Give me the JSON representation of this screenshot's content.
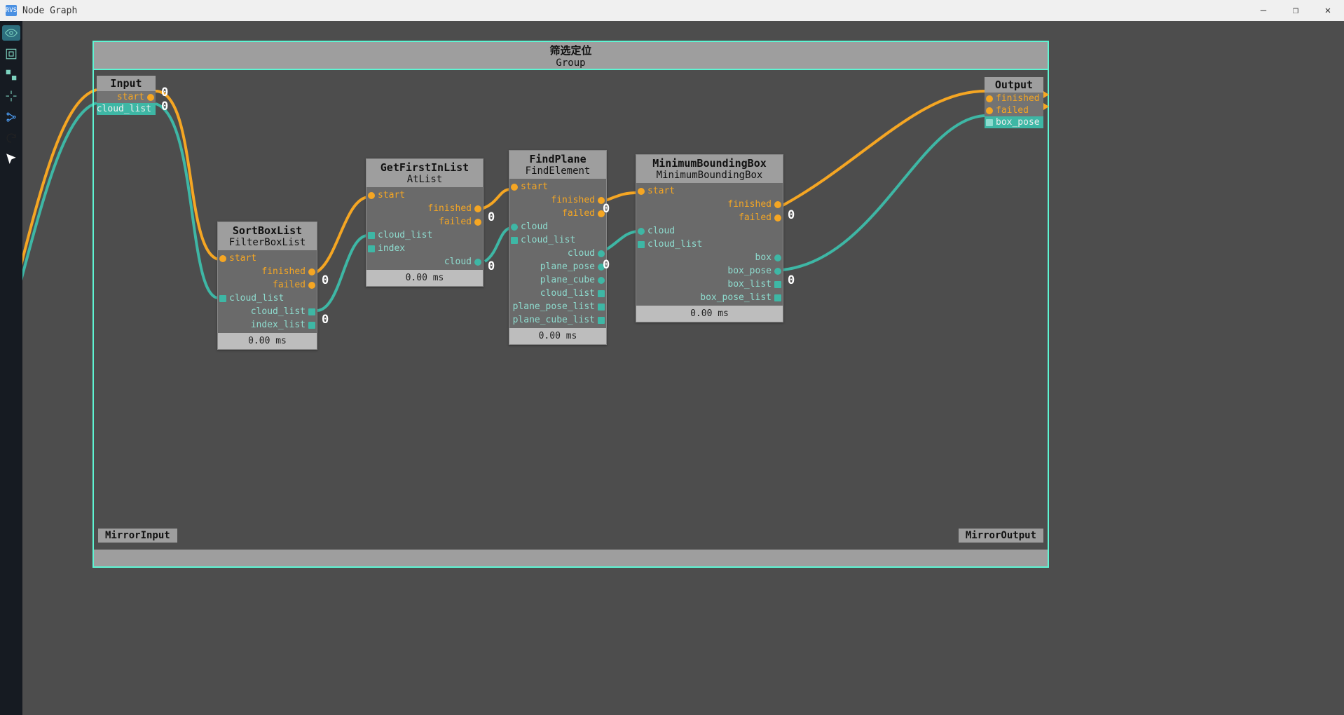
{
  "window": {
    "title": "Node Graph"
  },
  "winControls": {
    "min": "—",
    "max": "❐",
    "close": "✕"
  },
  "group": {
    "title": "筛选定位",
    "subtitle": "Group",
    "mirror_in": "MirrorInput",
    "mirror_out": "MirrorOutput"
  },
  "ioInput": {
    "title": "Input",
    "out_exec": "start",
    "out_data": "cloud_list"
  },
  "ioOutput": {
    "title": "Output",
    "in_finished": "finished",
    "in_failed": "failed",
    "in_box_pose": "box_pose"
  },
  "badges": {
    "zero": "0"
  },
  "nodes": {
    "sort": {
      "title": "SortBoxList",
      "subtitle": "FilterBoxList",
      "timing": "0.00 ms",
      "in_start": "start",
      "in_cloud_list": "cloud_list",
      "out_finished": "finished",
      "out_failed": "failed",
      "out_cloud_list": "cloud_list",
      "out_index_list": "index_list"
    },
    "getfirst": {
      "title": "GetFirstInList",
      "subtitle": "AtList",
      "timing": "0.00 ms",
      "in_start": "start",
      "in_cloud_list": "cloud_list",
      "in_index": "index",
      "out_finished": "finished",
      "out_failed": "failed",
      "out_cloud": "cloud"
    },
    "findplane": {
      "title": "FindPlane",
      "subtitle": "FindElement",
      "timing": "0.00 ms",
      "in_start": "start",
      "in_cloud": "cloud",
      "in_cloud_list": "cloud_list",
      "out_finished": "finished",
      "out_failed": "failed",
      "out_cloud": "cloud",
      "out_plane_pose": "plane_pose",
      "out_plane_cube": "plane_cube",
      "out_cloud_list": "cloud_list",
      "out_plane_pose_list": "plane_pose_list",
      "out_plane_cube_list": "plane_cube_list"
    },
    "mbb": {
      "title": "MinimumBoundingBox",
      "subtitle": "MinimumBoundingBox",
      "timing": "0.00 ms",
      "in_start": "start",
      "in_cloud": "cloud",
      "in_cloud_list": "cloud_list",
      "out_finished": "finished",
      "out_failed": "failed",
      "out_box": "box",
      "out_box_pose": "box_pose",
      "out_box_list": "box_list",
      "out_box_pose_list": "box_pose_list"
    }
  }
}
